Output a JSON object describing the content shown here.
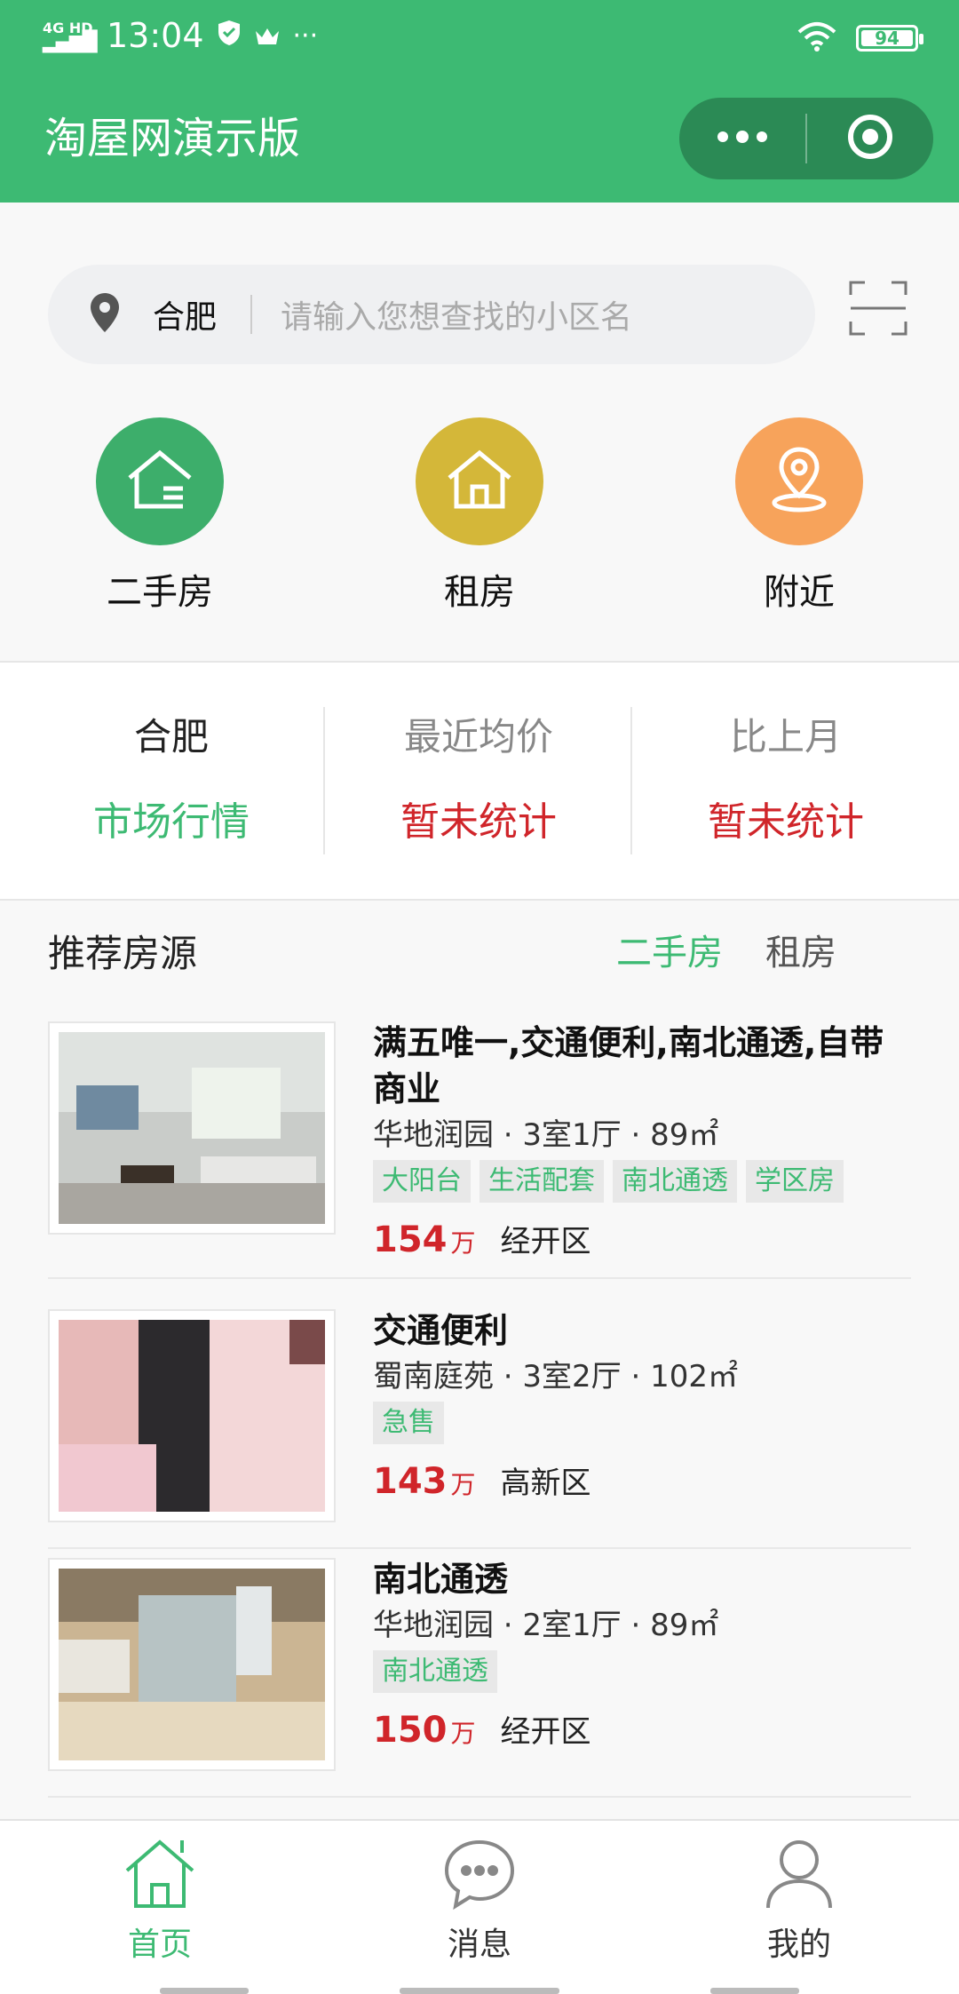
{
  "status": {
    "network": "4G HD",
    "time": "13:04",
    "battery": "94"
  },
  "header": {
    "title": "淘屋网演示版"
  },
  "search": {
    "city": "合肥",
    "placeholder": "请输入您想查找的小区名"
  },
  "quick_nav": [
    {
      "label": "二手房",
      "color": "#3dae6b"
    },
    {
      "label": "租房",
      "color": "#d4b739"
    },
    {
      "label": "附近",
      "color": "#f7a35b"
    }
  ],
  "market": {
    "city": "合肥",
    "city_sub": "市场行情",
    "avg_label": "最近均价",
    "avg_value": "暂未统计",
    "mom_label": "比上月",
    "mom_value": "暂未统计"
  },
  "recommend": {
    "title": "推荐房源",
    "tabs": [
      "二手房",
      "租房"
    ],
    "items": [
      {
        "name": "满五唯一,交通便利,南北通透,自带商业",
        "meta": "华地润园 · 3室1厅 · 89㎡",
        "tags": [
          "大阳台",
          "生活配套",
          "南北通透",
          "学区房"
        ],
        "price": "154",
        "unit": "万",
        "area": "经开区"
      },
      {
        "name": "交通便利",
        "meta": "蜀南庭苑 · 3室2厅 · 102㎡",
        "tags": [
          "急售"
        ],
        "price": "143",
        "unit": "万",
        "area": "高新区"
      },
      {
        "name": "南北通透",
        "meta": "华地润园 · 2室1厅 · 89㎡",
        "tags": [
          "南北通透"
        ],
        "price": "150",
        "unit": "万",
        "area": "经开区"
      }
    ]
  },
  "tabbar": [
    {
      "label": "首页",
      "active": true
    },
    {
      "label": "消息",
      "active": false
    },
    {
      "label": "我的",
      "active": false
    }
  ],
  "colors": {
    "brand": "#3dba73",
    "price": "#d0252a",
    "header": "#3dba73"
  }
}
